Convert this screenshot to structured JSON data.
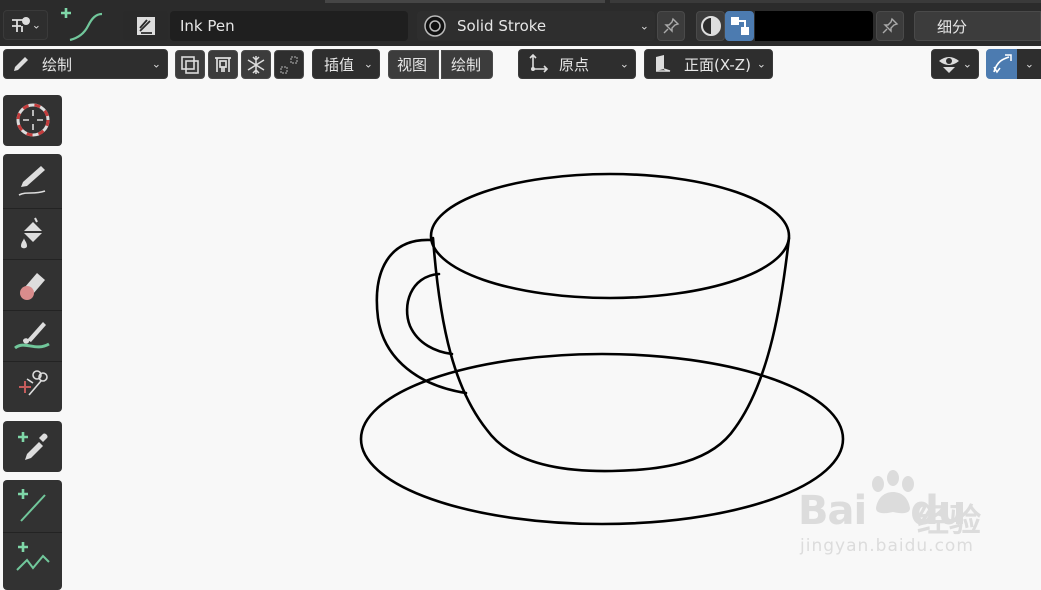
{
  "header": {
    "brush_name": "Ink Pen",
    "material_name": "Solid Stroke",
    "subdivide_label": "细分"
  },
  "toolbar": {
    "mode_label": "绘制",
    "interpolate_label": "插值",
    "view_label": "视图",
    "draw_label": "绘制",
    "origin_label": "原点",
    "plane_label": "正面(X-Z)"
  },
  "icons": {
    "header": [
      "draw-settings-icon",
      "pen-stroke-icon",
      "brush-icon",
      "material-icon",
      "pin-icon",
      "color-mode-icon",
      "vertex-color-icon",
      "pin-icon"
    ],
    "toolbar": [
      "pencil-icon",
      "multiframe-icon",
      "autokey-icon",
      "freeze-icon",
      "guides-icon",
      "origin-axis-icon",
      "plane-icon",
      "visibility-icon",
      "overlay-icon"
    ],
    "tools": [
      "cursor-icon",
      "draw-icon",
      "fill-icon",
      "erase-icon",
      "tint-icon",
      "cutter-icon",
      "eyedropper-icon",
      "line-icon",
      "polyline-icon"
    ]
  },
  "colors": {
    "header_bg": "#2b2b2b",
    "viewport_bg": "#f8f8f8",
    "active_blue": "#4c7bb0",
    "accent_green": "#71c79b"
  },
  "watermark": {
    "brand": "Bai",
    "brand_suffix": "du",
    "product": "经验",
    "url": "jingyan.baidu.com"
  }
}
